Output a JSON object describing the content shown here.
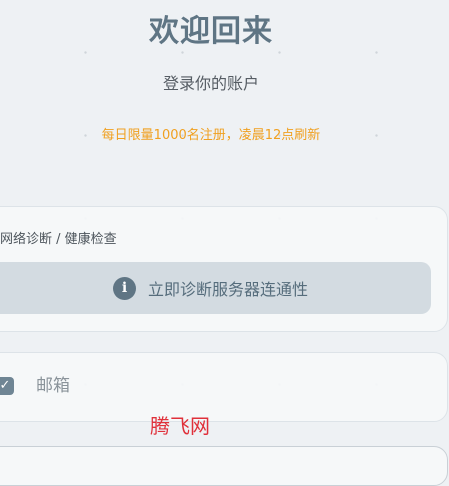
{
  "header": {
    "title": "欢迎回来",
    "subtitle": "登录你的账户",
    "notice": "每日限量1000名注册，凌晨12点刷新"
  },
  "diagnostics": {
    "label": "网络诊断 / 健康检查",
    "button_icon": "info-icon",
    "button_icon_glyph": "i",
    "button_label": "立即诊断服务器连通性"
  },
  "email": {
    "checkbox_icon": "check-icon",
    "checkbox_glyph": "✓",
    "placeholder": "邮箱",
    "value": ""
  },
  "watermark": {
    "text": "腾飞网"
  },
  "colors": {
    "title": "#5f7584",
    "notice": "#f0a020",
    "accent": "#5f7584",
    "watermark": "#e0303a"
  }
}
